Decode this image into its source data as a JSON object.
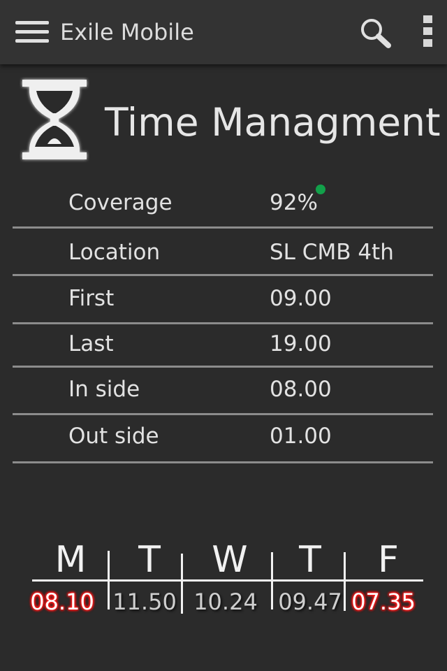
{
  "appbar": {
    "title": "Exile Mobile"
  },
  "header": {
    "title": "Time Managment",
    "icon": "hourglass-icon"
  },
  "info_rows": [
    {
      "label": "Coverage",
      "value": "92%"
    },
    {
      "label": "Location",
      "value": "SL CMB 4th"
    },
    {
      "label": "First",
      "value": "09.00"
    },
    {
      "label": "Last",
      "value": "19.00"
    },
    {
      "label": "In side",
      "value": "08.00"
    },
    {
      "label": "Out side",
      "value": "01.00"
    }
  ],
  "coverage_status_color": "#12a04a",
  "week": {
    "days": [
      "M",
      "T",
      "W",
      "T",
      "F"
    ],
    "times": [
      "08.10",
      "11.50",
      "10.24",
      "09.47",
      "07.35"
    ],
    "highlighted": [
      true,
      false,
      false,
      false,
      true
    ],
    "highlight_color": "#ff1f1f"
  }
}
